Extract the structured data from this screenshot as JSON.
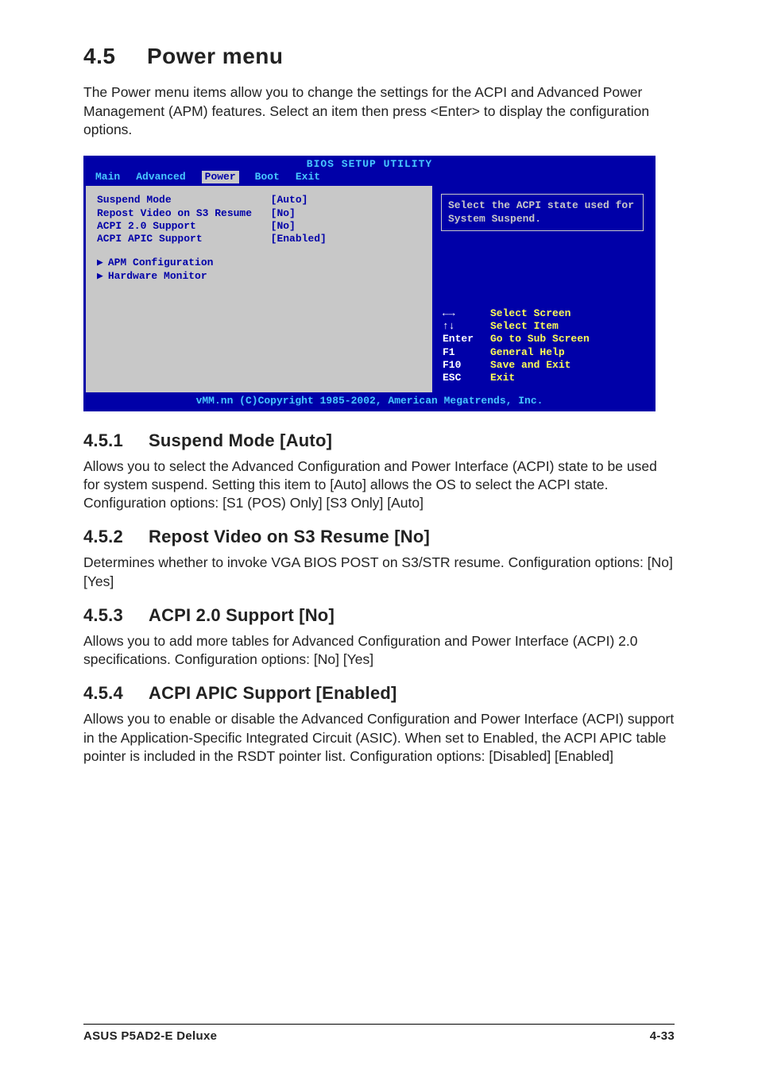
{
  "header": {
    "number": "4.5",
    "title": "Power menu",
    "intro": "The Power menu items allow you to change the settings for the ACPI and Advanced Power Management (APM) features. Select an item then press <Enter> to display the configuration options."
  },
  "bios": {
    "title": "BIOS SETUP UTILITY",
    "menu": [
      "Main",
      "Advanced",
      "Power",
      "Boot",
      "Exit"
    ],
    "selected_index": 2,
    "items": [
      {
        "label": "Suspend Mode",
        "value": "[Auto]"
      },
      {
        "label": "Repost Video on S3 Resume",
        "value": "[No]"
      },
      {
        "label": "ACPI 2.0 Support",
        "value": "[No]"
      },
      {
        "label": "ACPI APIC Support",
        "value": "[Enabled]"
      }
    ],
    "subitems": [
      "APM Configuration",
      "Hardware Monitor"
    ],
    "help": "Select the ACPI state used for System Suspend.",
    "keys": [
      {
        "k": "←→",
        "d": "Select Screen"
      },
      {
        "k": "↑↓",
        "d": "Select Item"
      },
      {
        "k": "Enter",
        "d": "Go to Sub Screen"
      },
      {
        "k": "F1",
        "d": "General Help"
      },
      {
        "k": "F10",
        "d": "Save and Exit"
      },
      {
        "k": "ESC",
        "d": "Exit"
      }
    ],
    "footer": "vMM.nn (C)Copyright 1985-2002, American Megatrends, Inc."
  },
  "sections": [
    {
      "num": "4.5.1",
      "title": "Suspend Mode [Auto]",
      "body": "Allows you to select the Advanced Configuration and Power Interface (ACPI) state to be used for system suspend. Setting this item to [Auto] allows the OS to select the ACPI state.\nConfiguration options: [S1 (POS) Only] [S3 Only] [Auto]"
    },
    {
      "num": "4.5.2",
      "title": "Repost Video on S3 Resume [No]",
      "body": "Determines whether to invoke VGA BIOS POST on S3/STR resume. Configuration options: [No] [Yes]"
    },
    {
      "num": "4.5.3",
      "title": "ACPI 2.0 Support [No]",
      "body": "Allows you to add more tables for Advanced Configuration and Power Interface (ACPI) 2.0 specifications. Configuration options: [No] [Yes]"
    },
    {
      "num": "4.5.4",
      "title": "ACPI APIC Support [Enabled]",
      "body": "Allows you to enable or disable the Advanced Configuration and Power Interface (ACPI) support in the Application-Specific Integrated Circuit (ASIC). When set to Enabled, the ACPI APIC table pointer is included in the RSDT pointer list. Configuration options: [Disabled] [Enabled]"
    }
  ],
  "footer": {
    "left": "ASUS P5AD2-E Deluxe",
    "right": "4-33"
  }
}
